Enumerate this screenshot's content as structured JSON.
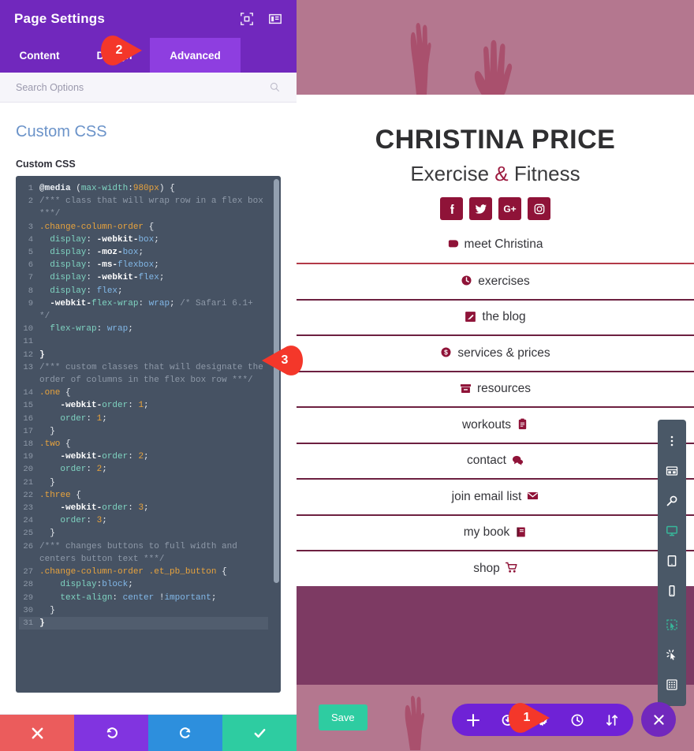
{
  "panel": {
    "title": "Page Settings",
    "header_icons": [
      "fullscreen-icon",
      "panel-layout-icon"
    ],
    "tabs": [
      {
        "label": "Content",
        "active": false
      },
      {
        "label": "Design",
        "active": false
      },
      {
        "label": "Advanced",
        "active": true
      }
    ],
    "search": {
      "placeholder": "Search Options",
      "value": ""
    },
    "section_title": "Custom CSS",
    "field_label": "Custom CSS",
    "actions": [
      {
        "name": "cancel-button",
        "icon": "close-icon",
        "color": "#eb5c5c"
      },
      {
        "name": "undo-button",
        "icon": "undo-icon",
        "color": "#8134e0"
      },
      {
        "name": "redo-button",
        "icon": "redo-icon",
        "color": "#2d8fdd"
      },
      {
        "name": "save-button",
        "icon": "check-icon",
        "color": "#2ecca1"
      }
    ]
  },
  "code": {
    "lines": [
      {
        "n": "1",
        "html": "<span class='k-at'>@media</span> <span class='k-pl'>(</span><span class='k-prop'>max-width</span><span class='k-pl'>:</span><span class='k-num'>980px</span><span class='k-pl'>) {</span>"
      },
      {
        "n": "2",
        "html": "<span class='k-com'>/*** class that will wrap row in a flex box ***/</span>"
      },
      {
        "n": "3",
        "html": "<span class='k-sel'>.change-column-order</span> <span class='k-pl'>{</span>"
      },
      {
        "n": "4",
        "html": "  <span class='k-prop'>display</span><span class='k-pl'>: </span><span class='k-white'>-webkit-</span><span class='k-val'>box</span><span class='k-pl'>;</span>"
      },
      {
        "n": "5",
        "html": "  <span class='k-prop'>display</span><span class='k-pl'>: </span><span class='k-white'>-moz-</span><span class='k-val'>box</span><span class='k-pl'>;</span>"
      },
      {
        "n": "6",
        "html": "  <span class='k-prop'>display</span><span class='k-pl'>: </span><span class='k-white'>-ms-</span><span class='k-val'>flexbox</span><span class='k-pl'>;</span>"
      },
      {
        "n": "7",
        "html": "  <span class='k-prop'>display</span><span class='k-pl'>: </span><span class='k-white'>-webkit-</span><span class='k-val'>flex</span><span class='k-pl'>;</span>"
      },
      {
        "n": "8",
        "html": "  <span class='k-prop'>display</span><span class='k-pl'>: </span><span class='k-val'>flex</span><span class='k-pl'>;</span>"
      },
      {
        "n": "9",
        "html": "  <span class='k-white'>-webkit-</span><span class='k-prop'>flex-wrap</span><span class='k-pl'>: </span><span class='k-val'>wrap</span><span class='k-pl'>; </span><span class='k-com'>/* Safari 6.1+ */</span>"
      },
      {
        "n": "10",
        "html": "  <span class='k-prop'>flex-wrap</span><span class='k-pl'>: </span><span class='k-val'>wrap</span><span class='k-pl'>;</span>"
      },
      {
        "n": "11",
        "html": ""
      },
      {
        "n": "12",
        "html": "<span class='k-white'>}</span>"
      },
      {
        "n": "13",
        "html": "<span class='k-com'>/*** custom classes that will designate the order of columns in the flex box row ***/</span>"
      },
      {
        "n": "14",
        "html": "<span class='k-sel'>.one</span> <span class='k-pl'>{</span>"
      },
      {
        "n": "15",
        "html": "    <span class='k-white'>-webkit-</span><span class='k-prop'>order</span><span class='k-pl'>: </span><span class='k-num'>1</span><span class='k-pl'>;</span>"
      },
      {
        "n": "16",
        "html": "    <span class='k-prop'>order</span><span class='k-pl'>: </span><span class='k-num'>1</span><span class='k-pl'>;</span>"
      },
      {
        "n": "17",
        "html": "  <span class='k-pl'>}</span>"
      },
      {
        "n": "18",
        "html": "<span class='k-sel'>.two</span> <span class='k-pl'>{</span>"
      },
      {
        "n": "19",
        "html": "    <span class='k-white'>-webkit-</span><span class='k-prop'>order</span><span class='k-pl'>: </span><span class='k-num'>2</span><span class='k-pl'>;</span>"
      },
      {
        "n": "20",
        "html": "    <span class='k-prop'>order</span><span class='k-pl'>: </span><span class='k-num'>2</span><span class='k-pl'>;</span>"
      },
      {
        "n": "21",
        "html": "  <span class='k-pl'>}</span>"
      },
      {
        "n": "22",
        "html": "<span class='k-sel'>.three</span> <span class='k-pl'>{</span>"
      },
      {
        "n": "23",
        "html": "    <span class='k-white'>-webkit-</span><span class='k-prop'>order</span><span class='k-pl'>: </span><span class='k-num'>3</span><span class='k-pl'>;</span>"
      },
      {
        "n": "24",
        "html": "    <span class='k-prop'>order</span><span class='k-pl'>: </span><span class='k-num'>3</span><span class='k-pl'>;</span>"
      },
      {
        "n": "25",
        "html": "  <span class='k-pl'>}</span>"
      },
      {
        "n": "26",
        "html": "<span class='k-com'>/*** changes buttons to full width and centers button text ***/</span>"
      },
      {
        "n": "27",
        "html": "<span class='k-sel'>.change-column-order</span> <span class='k-sel'>.et_pb_button</span> <span class='k-pl'>{</span>"
      },
      {
        "n": "28",
        "html": "    <span class='k-prop'>display</span><span class='k-pl'>:</span><span class='k-val'>block</span><span class='k-pl'>;</span>"
      },
      {
        "n": "29",
        "html": "    <span class='k-prop'>text-align</span><span class='k-pl'>: </span><span class='k-val'>center</span> <span class='k-pl'>!</span><span class='k-val'>important</span><span class='k-pl'>;</span>"
      },
      {
        "n": "30",
        "html": "  <span class='k-pl'>}</span>"
      },
      {
        "n": "31",
        "html": "<span class='k-white'>}</span>",
        "highlight": true
      }
    ]
  },
  "site": {
    "title": "CHRISTINA PRICE",
    "subtitle_part1": "Exercise ",
    "subtitle_amp": "&",
    "subtitle_part2": " Fitness",
    "socials": [
      {
        "name": "facebook-icon",
        "glyph": "f"
      },
      {
        "name": "twitter-icon",
        "glyph": "t"
      },
      {
        "name": "google-plus-icon",
        "glyph": "G+"
      },
      {
        "name": "instagram-icon",
        "glyph": "i"
      }
    ],
    "meet_link": "meet Christina",
    "meet_icon": "tag-icon",
    "menu": [
      {
        "label": "exercises",
        "icon": "clock-icon",
        "icon_pos": "before"
      },
      {
        "label": "the blog",
        "icon": "pencil-icon",
        "icon_pos": "before"
      },
      {
        "label": "services & prices",
        "icon": "dollar-icon",
        "icon_pos": "before"
      },
      {
        "label": "resources",
        "icon": "archive-icon",
        "icon_pos": "before"
      },
      {
        "label": "workouts",
        "icon": "clipboard-icon",
        "icon_pos": "after"
      },
      {
        "label": "contact",
        "icon": "chat-icon",
        "icon_pos": "after"
      },
      {
        "label": "join email list",
        "icon": "envelope-icon",
        "icon_pos": "after"
      },
      {
        "label": "my book",
        "icon": "book-icon",
        "icon_pos": "after"
      },
      {
        "label": "shop",
        "icon": "cart-icon",
        "icon_pos": "after"
      }
    ]
  },
  "builder": {
    "save_label": "Save",
    "toolbar_icons": [
      "plus-icon",
      "save-disk-icon",
      "gear-icon",
      "history-icon",
      "sort-icon"
    ],
    "close_icon": "close-icon",
    "vtool_top": [
      "kebab-menu-icon",
      "wireframe-icon",
      "zoom-icon",
      "desktop-icon",
      "tablet-icon",
      "phone-icon"
    ],
    "vtool_top_active": "desktop-icon",
    "vtool_bottom": [
      "select-icon",
      "click-icon",
      "grid-icon"
    ]
  },
  "markers": [
    {
      "id": "1",
      "label": "1"
    },
    {
      "id": "2",
      "label": "2"
    },
    {
      "id": "3",
      "label": "3"
    }
  ],
  "colors": {
    "panel_purple": "#7128bd",
    "tab_active": "#8e3ee0",
    "accent_teal": "#2ecca1",
    "marker_red": "#f4372a",
    "site_maroon": "#8f1338",
    "code_bg": "#465263"
  }
}
